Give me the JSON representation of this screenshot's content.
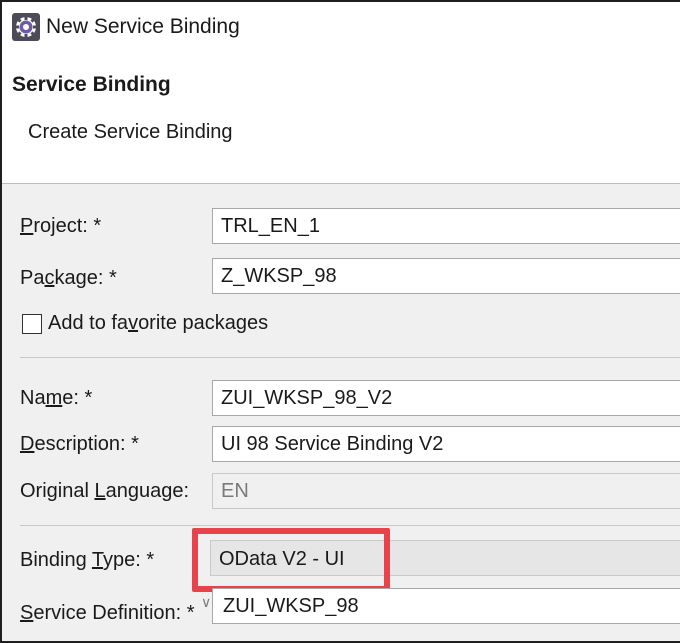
{
  "window": {
    "title": "New Service Binding",
    "icon": "eclipse-gear-icon"
  },
  "header": {
    "title": "Service Binding",
    "subtitle": "Create Service Binding"
  },
  "form": {
    "project": {
      "label_before": "",
      "label_mnemonic": "P",
      "label_after": "roject: *",
      "value": "TRL_EN_1"
    },
    "package": {
      "label_before": "Pa",
      "label_mnemonic": "c",
      "label_after": "kage: *",
      "value": "Z_WKSP_98"
    },
    "favorite": {
      "label_before": "Add to fa",
      "label_mnemonic": "v",
      "label_after": "orite packages",
      "checked": false
    },
    "name": {
      "label_before": "Na",
      "label_mnemonic": "m",
      "label_after": "e: *",
      "value": "ZUI_WKSP_98_V2"
    },
    "description": {
      "label_before": "",
      "label_mnemonic": "D",
      "label_after": "escription: *",
      "value": "UI 98 Service Binding V2"
    },
    "original_language": {
      "label_before": "Original ",
      "label_mnemonic": "L",
      "label_after": "anguage:",
      "value": "EN"
    },
    "binding_type": {
      "label_before": "Binding ",
      "label_mnemonic": "T",
      "label_after": "ype: *",
      "value": "OData V2 - UI"
    },
    "service_definition": {
      "label_before": "",
      "label_mnemonic": "S",
      "label_after": "ervice Definition: *",
      "value": "ZUI_WKSP_98"
    }
  },
  "colors": {
    "highlight": "#e8434b",
    "panel_background": "#f0f0f0"
  }
}
